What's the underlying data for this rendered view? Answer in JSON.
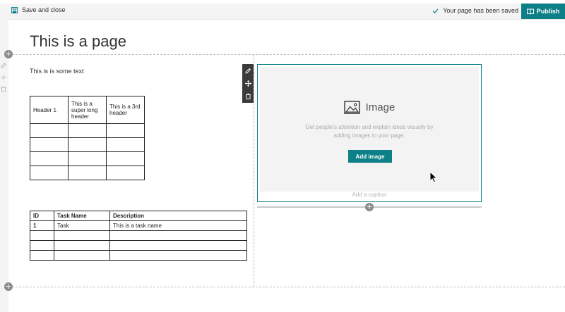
{
  "topbar": {
    "save_close_label": "Save and close",
    "save_icon": "save-icon",
    "saved_status": "Your page has been saved",
    "check_icon": "check-icon",
    "publish_label": "Publish",
    "publish_icon": "book-icon"
  },
  "page": {
    "title": "This is a page",
    "body_text": "This is is some text"
  },
  "table1": {
    "headers": [
      "Header 1",
      "This is a super long header",
      "This is a 3rd header"
    ],
    "rows": [
      [
        "",
        "",
        ""
      ],
      [
        "",
        "",
        ""
      ],
      [
        "",
        "",
        ""
      ],
      [
        "",
        "",
        ""
      ]
    ]
  },
  "table2": {
    "headers": [
      "ID",
      "Task Name",
      "Description"
    ],
    "rows": [
      [
        "1",
        "Task",
        "This is a task name"
      ],
      [
        "",
        "",
        ""
      ],
      [
        "",
        "",
        ""
      ],
      [
        "",
        "",
        ""
      ]
    ]
  },
  "webpart_toolbar": {
    "icons": [
      "edit-pencil-icon",
      "move-icon",
      "trash-icon"
    ]
  },
  "image_webpart": {
    "heading": "Image",
    "description": "Get people's attention and explain ideas visually by adding images to your page.",
    "add_button_label": "Add image",
    "caption_placeholder": "Add a caption",
    "icon": "image-icon"
  },
  "colors": {
    "accent": "#0d7f87",
    "toolbar_dark": "#3b3b3b",
    "section_line": "#b8b8b8"
  }
}
